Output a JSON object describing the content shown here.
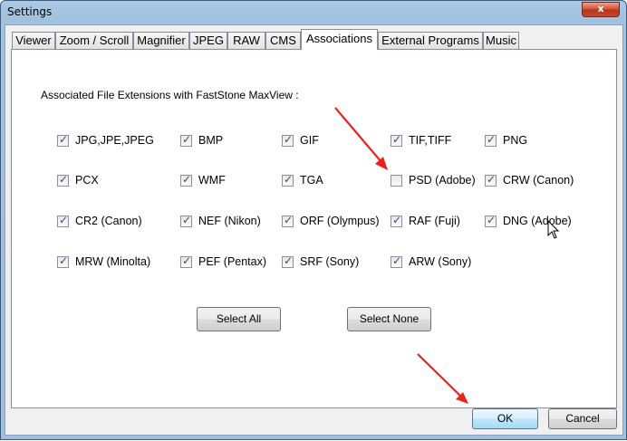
{
  "window": {
    "title": "Settings",
    "close_glyph": "x"
  },
  "tabs": [
    {
      "label": "Viewer",
      "active": false
    },
    {
      "label": "Zoom / Scroll",
      "active": false
    },
    {
      "label": "Magnifier",
      "active": false
    },
    {
      "label": "JPEG",
      "active": false
    },
    {
      "label": "RAW",
      "active": false
    },
    {
      "label": "CMS",
      "active": false
    },
    {
      "label": "Associations",
      "active": true
    },
    {
      "label": "External Programs",
      "active": false
    },
    {
      "label": "Music",
      "active": false
    }
  ],
  "associations": {
    "heading": "Associated File Extensions with FastStone MaxView :",
    "rows": [
      [
        {
          "label": "JPG,JPE,JPEG",
          "checked": true
        },
        {
          "label": "BMP",
          "checked": true
        },
        {
          "label": "GIF",
          "checked": true
        },
        {
          "label": "TIF,TIFF",
          "checked": true
        },
        {
          "label": "PNG",
          "checked": true
        }
      ],
      [
        {
          "label": "PCX",
          "checked": true
        },
        {
          "label": "WMF",
          "checked": true
        },
        {
          "label": "TGA",
          "checked": true
        },
        {
          "label": "PSD (Adobe)",
          "checked": false
        },
        {
          "label": "CRW (Canon)",
          "checked": true
        }
      ],
      [
        {
          "label": "CR2 (Canon)",
          "checked": true
        },
        {
          "label": "NEF (Nikon)",
          "checked": true
        },
        {
          "label": "ORF (Olympus)",
          "checked": true
        },
        {
          "label": "RAF (Fuji)",
          "checked": true
        },
        {
          "label": "DNG (Adobe)",
          "checked": true
        }
      ],
      [
        {
          "label": "MRW (Minolta)",
          "checked": true
        },
        {
          "label": "PEF (Pentax)",
          "checked": true
        },
        {
          "label": "SRF (Sony)",
          "checked": true
        },
        {
          "label": "ARW (Sony)",
          "checked": true
        }
      ]
    ],
    "select_all_label": "Select All",
    "select_none_label": "Select None"
  },
  "footer": {
    "ok_label": "OK",
    "cancel_label": "Cancel"
  },
  "annotation_color": "#e8231e",
  "cursor_icon": "mouse-pointer-icon"
}
